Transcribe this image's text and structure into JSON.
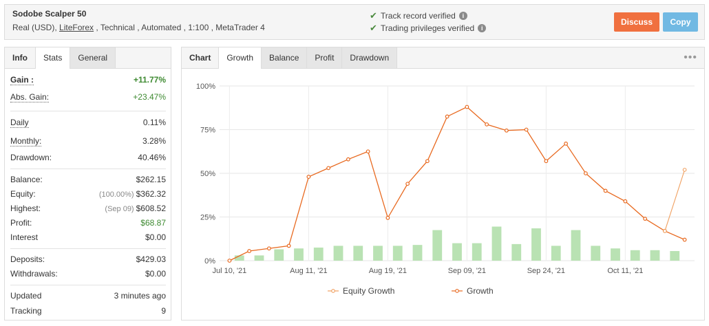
{
  "header": {
    "system_name": "Sodobe Scalper 50",
    "subtitle_pre": "Real (USD), ",
    "broker": "LiteForex",
    "subtitle_post": " , Technical , Automated , 1:100 , MetaTrader 4",
    "verifications": [
      "Track record verified",
      "Trading privileges verified"
    ],
    "discuss_label": "Discuss",
    "copy_label": "Copy"
  },
  "left_tabs": [
    "Info",
    "Stats",
    "General"
  ],
  "stats": {
    "gain": {
      "label": "Gain :",
      "value": "+11.77%"
    },
    "abs_gain": {
      "label": "Abs. Gain:",
      "value": "+23.47%"
    },
    "daily": {
      "label": "Daily",
      "value": "0.11%"
    },
    "monthly": {
      "label": "Monthly:",
      "value": "3.28%"
    },
    "drawdown": {
      "label": "Drawdown:",
      "value": "40.46%"
    },
    "balance": {
      "label": "Balance:",
      "value": "$262.15"
    },
    "equity": {
      "label": "Equity:",
      "pre": "(100.00%)",
      "value": "$362.32"
    },
    "highest": {
      "label": "Highest:",
      "pre": "(Sep 09)",
      "value": "$608.52"
    },
    "profit": {
      "label": "Profit:",
      "value": "$68.87"
    },
    "interest": {
      "label": "Interest",
      "value": "$0.00"
    },
    "deposits": {
      "label": "Deposits:",
      "value": "$429.03"
    },
    "withdrawals": {
      "label": "Withdrawals:",
      "value": "$0.00"
    },
    "updated": {
      "label": "Updated",
      "value": "3 minutes ago"
    },
    "tracking": {
      "label": "Tracking",
      "value": "9"
    }
  },
  "chart_tabs": [
    "Chart",
    "Growth",
    "Balance",
    "Profit",
    "Drawdown"
  ],
  "chart_data": {
    "type": "line",
    "y_ticks": [
      "100%",
      "75%",
      "50%",
      "25%",
      "0%"
    ],
    "ylim": [
      0,
      100
    ],
    "x_tick_labels": [
      "Jul 10, '21",
      "Aug 11, '21",
      "Aug 19, '21",
      "Sep 09, '21",
      "Sep 24, '21",
      "Oct 11, '21"
    ],
    "x_tick_index": [
      0,
      4,
      8,
      12,
      16,
      20
    ],
    "grid": true,
    "legend_position": "bottom",
    "colors": {
      "growth": "#e8691f",
      "equity": "#f0a060",
      "bars": "#b9e2b3"
    },
    "series": [
      {
        "name": "Growth",
        "values": [
          0,
          5.5,
          7,
          8.5,
          48,
          53,
          58,
          62.5,
          24.5,
          44,
          57,
          82.5,
          88,
          78,
          74.5,
          75,
          57,
          67,
          50,
          40,
          34,
          24,
          17,
          12
        ]
      },
      {
        "name": "Equity Growth",
        "values": [
          null,
          null,
          null,
          null,
          null,
          null,
          null,
          null,
          null,
          null,
          null,
          null,
          null,
          null,
          null,
          null,
          null,
          null,
          null,
          null,
          null,
          null,
          17,
          52
        ]
      }
    ],
    "bars": [
      3,
      3,
      6.5,
      7,
      7.5,
      8.5,
      8.5,
      8.5,
      8.5,
      9,
      17.5,
      10,
      10,
      19.5,
      9.5,
      18.5,
      8.5,
      17.5,
      8.5,
      7,
      6,
      6,
      5.5
    ],
    "legend": [
      "Equity Growth",
      "Growth"
    ]
  }
}
